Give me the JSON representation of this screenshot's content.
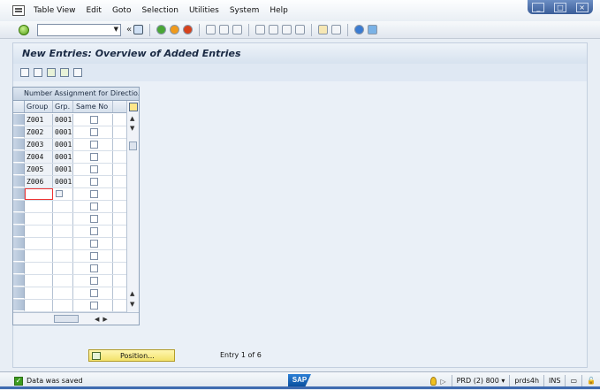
{
  "menu": {
    "items": [
      "Table View",
      "Edit",
      "Goto",
      "Selection",
      "Utilities",
      "System",
      "Help"
    ]
  },
  "toolbar": {
    "command_value": "",
    "back_glyph": "«"
  },
  "screen": {
    "title": "New Entries: Overview of Added Entries"
  },
  "table": {
    "title": "Number Assignment for Directio...",
    "columns": [
      "Group",
      "Grp.",
      "Same No"
    ],
    "rows": [
      {
        "group": "Z001",
        "grp": "0001",
        "same_no": false
      },
      {
        "group": "Z002",
        "grp": "0001",
        "same_no": false
      },
      {
        "group": "Z003",
        "grp": "0001",
        "same_no": false
      },
      {
        "group": "Z004",
        "grp": "0001",
        "same_no": false
      },
      {
        "group": "Z005",
        "grp": "0001",
        "same_no": false
      },
      {
        "group": "Z006",
        "grp": "0001",
        "same_no": false
      }
    ],
    "empty_rows": 10
  },
  "footer": {
    "position_label": "Position...",
    "entry_info": "Entry 1 of 6"
  },
  "status": {
    "message": "Data was saved",
    "logo": "SAP",
    "system": "PRD (2) 800",
    "server": "prds4h",
    "mode": "INS"
  },
  "colors": {
    "accent": "#3f6bb0",
    "active_cell": "#fff5b0",
    "position_button": "#f3e26a"
  }
}
